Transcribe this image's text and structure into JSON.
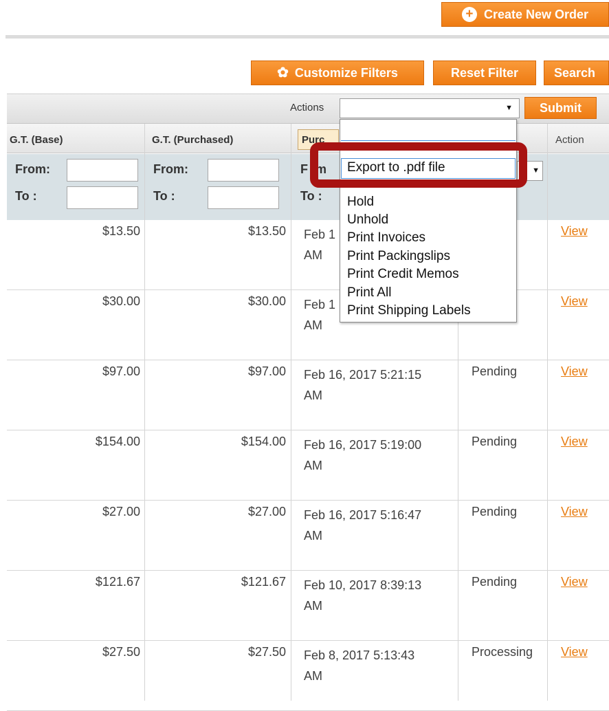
{
  "toolbar": {
    "create_order_label": "Create New Order",
    "customize_filters_label": "Customize Filters",
    "reset_filter_label": "Reset Filter",
    "search_label": "Search"
  },
  "massaction": {
    "actions_label": "Actions",
    "selected_value": "",
    "submit_label": "Submit",
    "options": [
      "",
      "Export to .pdf file",
      "Hold",
      "Unhold",
      "Print Invoices",
      "Print Packingslips",
      "Print Credit Memos",
      "Print All",
      "Print Shipping Labels"
    ]
  },
  "grid": {
    "headers": {
      "gt_base": "G.T. (Base)",
      "gt_purchased": "G.T. (Purchased)",
      "purchased_on": "Purc",
      "action": "Action"
    },
    "filters": {
      "from_label": "From:",
      "to_label": "To :",
      "date_from_label": "F",
      "date_from_label_tail": "m",
      "date_to_label": "To :"
    },
    "rows": [
      {
        "gt_base": "$13.50",
        "gt_purchased": "$13.50",
        "date_line1": "Feb 1",
        "date_line2": "AM",
        "status": "",
        "action": "View"
      },
      {
        "gt_base": "$30.00",
        "gt_purchased": "$30.00",
        "date_line1": "Feb 1",
        "date_line2": "AM",
        "status": "",
        "action": "View"
      },
      {
        "gt_base": "$97.00",
        "gt_purchased": "$97.00",
        "date_line1": "Feb 16, 2017 5:21:15",
        "date_line2": "AM",
        "status": "Pending",
        "action": "View"
      },
      {
        "gt_base": "$154.00",
        "gt_purchased": "$154.00",
        "date_line1": "Feb 16, 2017 5:19:00",
        "date_line2": "AM",
        "status": "Pending",
        "action": "View"
      },
      {
        "gt_base": "$27.00",
        "gt_purchased": "$27.00",
        "date_line1": "Feb 16, 2017 5:16:47",
        "date_line2": "AM",
        "status": "Pending",
        "action": "View"
      },
      {
        "gt_base": "$121.67",
        "gt_purchased": "$121.67",
        "date_line1": "Feb 10, 2017 8:39:13",
        "date_line2": "AM",
        "status": "Pending",
        "action": "View"
      },
      {
        "gt_base": "$27.50",
        "gt_purchased": "$27.50",
        "date_line1": "Feb 8, 2017 5:13:43",
        "date_line2": "AM",
        "status": "Processing",
        "action": "View"
      }
    ]
  },
  "colors": {
    "accent_orange": "#ef7f1a",
    "highlight_red": "#a81312",
    "link_orange": "#e87c10",
    "filter_row_bg": "#d8e1e5"
  }
}
